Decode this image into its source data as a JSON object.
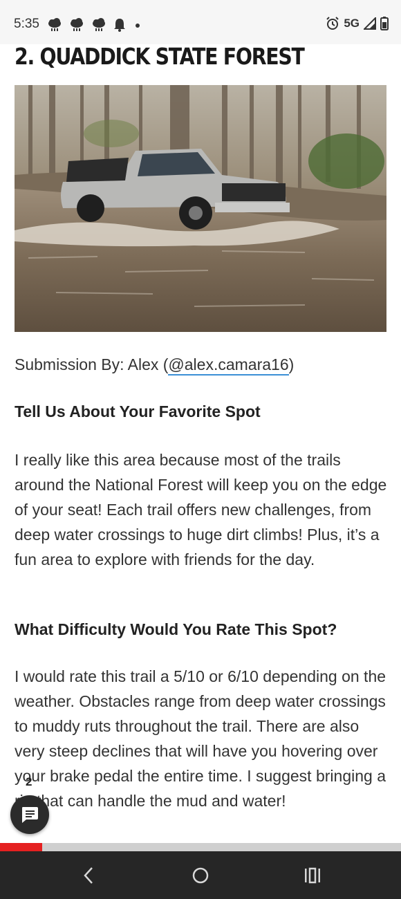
{
  "status_bar": {
    "time": "5:35",
    "left_icons": [
      "cloud-rain-icon",
      "cloud-rain-icon",
      "cloud-rain-icon",
      "bell-icon",
      "dot-icon"
    ],
    "network": "5G",
    "right_icons": [
      "alarm-icon",
      "signal-icon",
      "battery-icon"
    ]
  },
  "article": {
    "heading": "2. QUADDICK STATE FOREST",
    "image_alt": "Silver pickup truck crossing a flooded trail in the forest",
    "submission_prefix": "Submission By: Alex (",
    "submission_handle": "@alex.camara16",
    "submission_suffix": ")",
    "favorite_heading": "Tell Us About Your Favorite Spot",
    "favorite_text": "I really like this area because most of the trails around the National Forest will keep you on the edge of your seat! Each trail offers new challenges, from deep water crossings to huge dirt climbs! Plus, it’s a fun area to explore with friends for the day.",
    "difficulty_heading": "What Difficulty Would You Rate This Spot?",
    "difficulty_text": "I would rate this trail a 5/10 or 6/10 depending on the weather. Obstacles range from deep water crossings to muddy ruts throughout the trail. There are also very steep declines that will have you hovering over your brake pedal the entire time. I suggest bringing a rig that can handle the mud and water!"
  },
  "comments": {
    "count": "2",
    "icon": "comment-icon"
  },
  "reading_progress": {
    "fraction": 0.105,
    "color": "#e52020"
  },
  "nav_bar": {
    "buttons": [
      "back-icon",
      "home-icon",
      "recents-icon"
    ]
  },
  "colors": {
    "link_underline": "#3a8fd6",
    "nav_bg": "#262626",
    "status_bg": "#f6f6f6"
  }
}
